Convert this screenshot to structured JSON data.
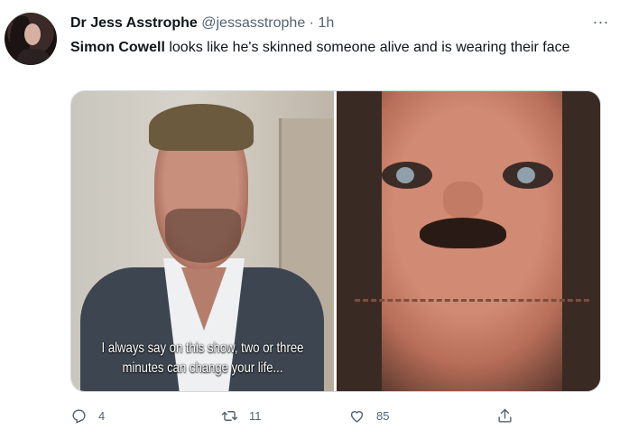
{
  "tweet": {
    "display_name": "Dr Jess Asstrophe",
    "handle": "@jessasstrophe",
    "separator": "·",
    "time": "1h",
    "more_icon": "...",
    "text_bold": "Simon Cowell",
    "text_rest": " looks like he's skinned someone alive and is wearing their face",
    "media": {
      "left_caption_line1": "I always say on this show, two or three",
      "left_caption_line2": "minutes can change your life..."
    },
    "actions": {
      "reply_count": "4",
      "retweet_count": "11",
      "like_count": "85"
    }
  },
  "icons": [
    "reply-icon",
    "retweet-icon",
    "like-icon",
    "share-icon",
    "more-icon"
  ],
  "colors": {
    "text": "#0f1419",
    "muted": "#536471",
    "border": "#cfd9de"
  }
}
